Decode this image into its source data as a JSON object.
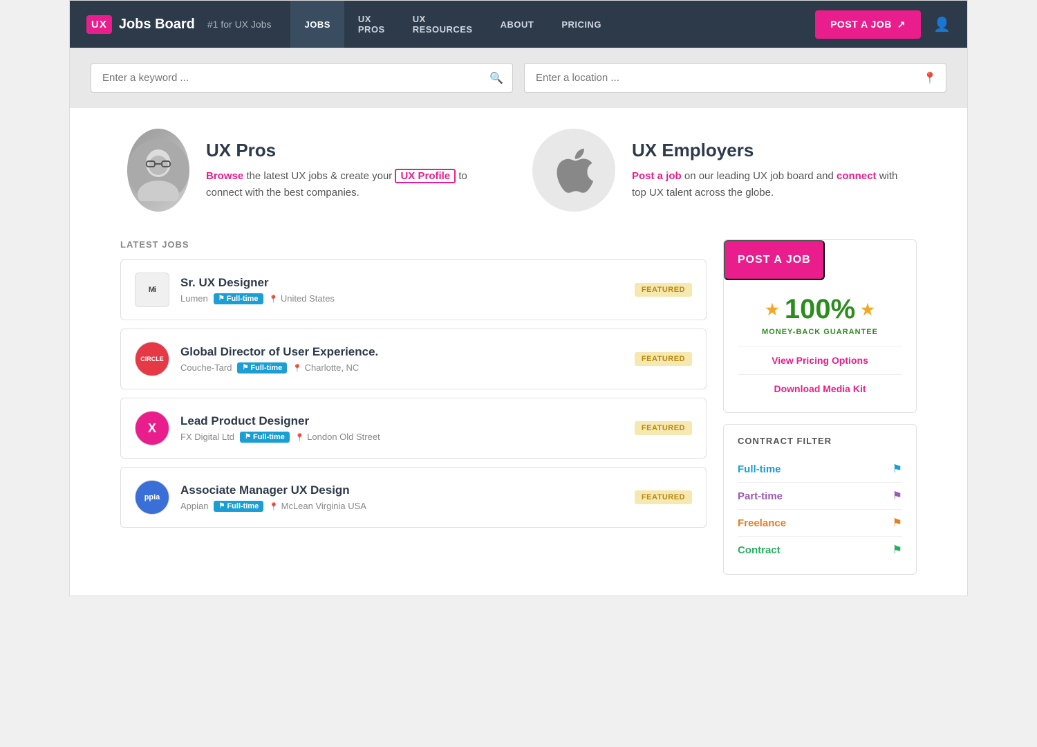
{
  "navbar": {
    "logo_text": "UX",
    "brand": "Jobs Board",
    "tagline": "#1 for UX Jobs",
    "nav_items": [
      {
        "label": "JOBS",
        "active": true
      },
      {
        "label": "UX PROS",
        "active": false
      },
      {
        "label": "UX RESOURCES",
        "active": false
      },
      {
        "label": "ABOUT",
        "active": false
      },
      {
        "label": "PRICING",
        "active": false
      }
    ],
    "post_job_button": "POST A JOB",
    "external_icon": "↗"
  },
  "search": {
    "keyword_placeholder": "Enter a keyword ...",
    "location_placeholder": "Enter a location ..."
  },
  "promo": {
    "ux_pros": {
      "heading": "UX Pros",
      "browse_text": "Browse",
      "middle_text": " the latest UX jobs & create your ",
      "profile_text": "UX Profile",
      "end_text": " to connect with the best companies."
    },
    "ux_employers": {
      "heading": "UX Employers",
      "post_text": "Post a job",
      "middle_text": " on our leading UX job board and ",
      "connect_text": "connect",
      "end_text": " with top UX talent across the globe."
    }
  },
  "jobs": {
    "section_label": "LATEST JOBS",
    "items": [
      {
        "id": 1,
        "logo_text": "Mi",
        "logo_class": "logo-mi",
        "title": "Sr. UX Designer",
        "company": "Lumen",
        "employment": "Full-time",
        "location": "United States",
        "featured": true,
        "featured_label": "FEATURED"
      },
      {
        "id": 2,
        "logo_text": "CIRCLE",
        "logo_class": "logo-circle",
        "title": "Global Director of User Experience.",
        "company": "Couche-Tard",
        "employment": "Full-time",
        "location": "Charlotte, NC",
        "featured": true,
        "featured_label": "FEATURED"
      },
      {
        "id": 3,
        "logo_text": "X",
        "logo_class": "logo-x",
        "title": "Lead Product Designer",
        "company": "FX Digital Ltd",
        "employment": "Full-time",
        "location": "London Old Street",
        "featured": true,
        "featured_label": "FEATURED"
      },
      {
        "id": 4,
        "logo_text": "ppia",
        "logo_class": "logo-ppia",
        "title": "Associate Manager UX Design",
        "company": "Appian",
        "employment": "Full-time",
        "location": "McLean Virginia USA",
        "featured": true,
        "featured_label": "FEATURED"
      }
    ]
  },
  "sidebar": {
    "post_job_label": "POST A JOB",
    "guarantee_percent": "100%",
    "guarantee_label": "MONEY-BACK GUARANTEE",
    "view_pricing": "View Pricing Options",
    "download_media": "Download Media Kit",
    "contract_filter_title": "CONTRACT FILTER",
    "contract_items": [
      {
        "label": "Full-time",
        "color_class": "contract-fulltime",
        "flag_class": "flag-blue"
      },
      {
        "label": "Part-time",
        "color_class": "contract-parttime",
        "flag_class": "flag-purple"
      },
      {
        "label": "Freelance",
        "color_class": "contract-freelance",
        "flag_class": "flag-orange"
      },
      {
        "label": "Contract",
        "color_class": "contract-contract",
        "flag_class": "flag-green"
      }
    ]
  }
}
